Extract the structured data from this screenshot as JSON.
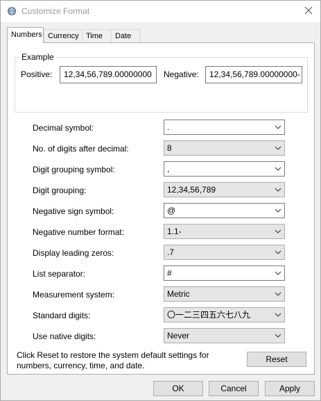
{
  "window": {
    "title": "Customize Format"
  },
  "tabs": [
    {
      "label": "Numbers",
      "active": true
    },
    {
      "label": "Currency",
      "active": false
    },
    {
      "label": "Time",
      "active": false
    },
    {
      "label": "Date",
      "active": false
    }
  ],
  "example": {
    "group_label": "Example",
    "positive_label": "Positive:",
    "positive_value": "12,34,56,789.00000000",
    "negative_label": "Negative:",
    "negative_value": "12,34,56,789.00000000-"
  },
  "settings": [
    {
      "label": "Decimal symbol:",
      "value": ".",
      "kind": "editable"
    },
    {
      "label": "No. of digits after decimal:",
      "value": "8",
      "kind": "dropdown"
    },
    {
      "label": "Digit grouping symbol:",
      "value": ",",
      "kind": "editable"
    },
    {
      "label": "Digit grouping:",
      "value": "12,34,56,789",
      "kind": "dropdown"
    },
    {
      "label": "Negative sign symbol:",
      "value": "@",
      "kind": "editable"
    },
    {
      "label": "Negative number format:",
      "value": "1.1-",
      "kind": "dropdown"
    },
    {
      "label": "Display leading zeros:",
      "value": ".7",
      "kind": "dropdown"
    },
    {
      "label": "List separator:",
      "value": "#",
      "kind": "editable"
    },
    {
      "label": "Measurement system:",
      "value": "Metric",
      "kind": "dropdown"
    },
    {
      "label": "Standard digits:",
      "value": "〇一二三四五六七八九",
      "kind": "dropdown"
    },
    {
      "label": "Use native digits:",
      "value": "Never",
      "kind": "dropdown"
    }
  ],
  "reset": {
    "text_line1": "Click Reset to restore the system default settings for",
    "text_line2": "numbers, currency, time, and date.",
    "button_label": "Reset"
  },
  "footer": {
    "ok_label": "OK",
    "cancel_label": "Cancel",
    "apply_label": "Apply"
  },
  "colors": {
    "window_bg": "#f0f0f0",
    "panel_bg": "#ffffff",
    "title_text": "#999999",
    "dropdown_bg": "#e5e5e5",
    "button_bg": "#e1e1e1"
  },
  "icons": {
    "title": "region-globe-icon",
    "close": "close-icon",
    "combo_arrow": "chevron-down-icon"
  }
}
